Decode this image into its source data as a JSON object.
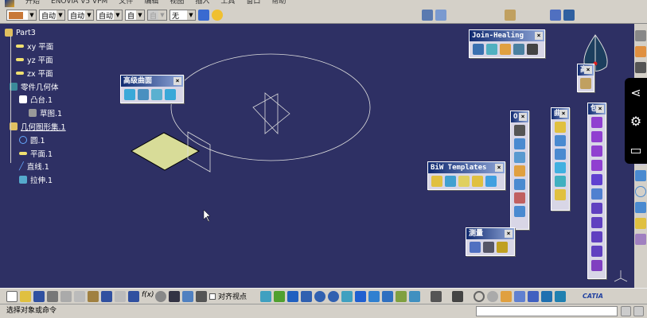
{
  "menu": [
    "开始",
    "ENOVIA V5 VPM",
    "文件",
    "编辑",
    "视图",
    "插入",
    "工具",
    "窗口",
    "帮助"
  ],
  "graphic_props": {
    "color": "#c87838",
    "line_type": "自动",
    "line_weight": "自动",
    "point": "自动",
    "layer1": "自",
    "layer2": "自",
    "layer": "无"
  },
  "tree": {
    "root": "Part3",
    "items": [
      "xy 平面",
      "yz 平面",
      "zx 平面",
      "零件几何体",
      "凸台.1",
      "草图.1",
      "几何图形集.1",
      "圆.1",
      "平面.1",
      "直线.1",
      "拉伸.1"
    ]
  },
  "toolbars": {
    "advanced_surfaces": "高级曲面",
    "join_healing": "Join-Healing",
    "high": "高",
    "ops": "O.",
    "curves": "曲",
    "wrap": "包.",
    "biw": "BiW Templates",
    "measure": "测量"
  },
  "bottom": {
    "align_label": "对齐视点",
    "brand": "CATIA"
  },
  "status": {
    "text": "选择对象或命令",
    "command_input": ""
  },
  "colors": {
    "background": "#2e3064",
    "sketch_plane": "#d8dc98"
  }
}
